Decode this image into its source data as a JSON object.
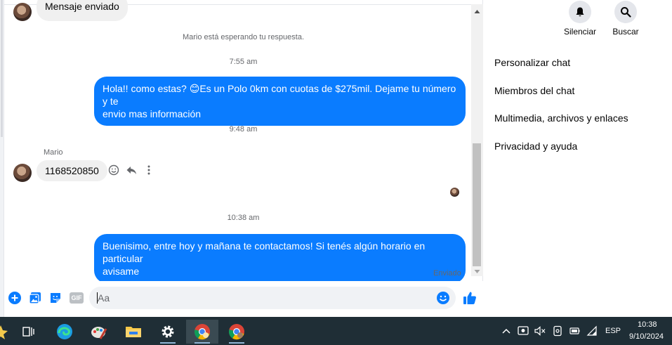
{
  "chat": {
    "top_message": "Mensaje enviado",
    "waiting_notice": "Mario está esperando tu respuesta.",
    "time_1": "7:55 am",
    "out_message_1_line1": "Hola!! como estas? 😊Es un Polo 0km con cuotas de $275mil. Dejame tu número y te",
    "out_message_1_line2": "envio mas información",
    "time_2": "9:48 am",
    "sender_name": "Mario",
    "in_message": "1168520850",
    "time_3": "10:38 am",
    "out_message_2_line1": "Buenisimo, entre hoy y mañana te contactamos! Si tenés algún horario en particular",
    "out_message_2_line2": "avisame",
    "delivery_status": "Enviado"
  },
  "composer": {
    "placeholder": "Aa",
    "gif_label": "GIF"
  },
  "right_panel": {
    "mute_label": "Silenciar",
    "search_label": "Buscar",
    "menu": [
      {
        "label": "Personalizar chat"
      },
      {
        "label": "Miembros del chat"
      },
      {
        "label": "Multimedia, archivos y enlaces"
      },
      {
        "label": "Privacidad y ayuda"
      }
    ]
  },
  "taskbar": {
    "language": "ESP",
    "time": "10:38",
    "date": "9/10/2024"
  },
  "colors": {
    "accent": "#0a7cff",
    "taskbar": "#1f2e36"
  }
}
